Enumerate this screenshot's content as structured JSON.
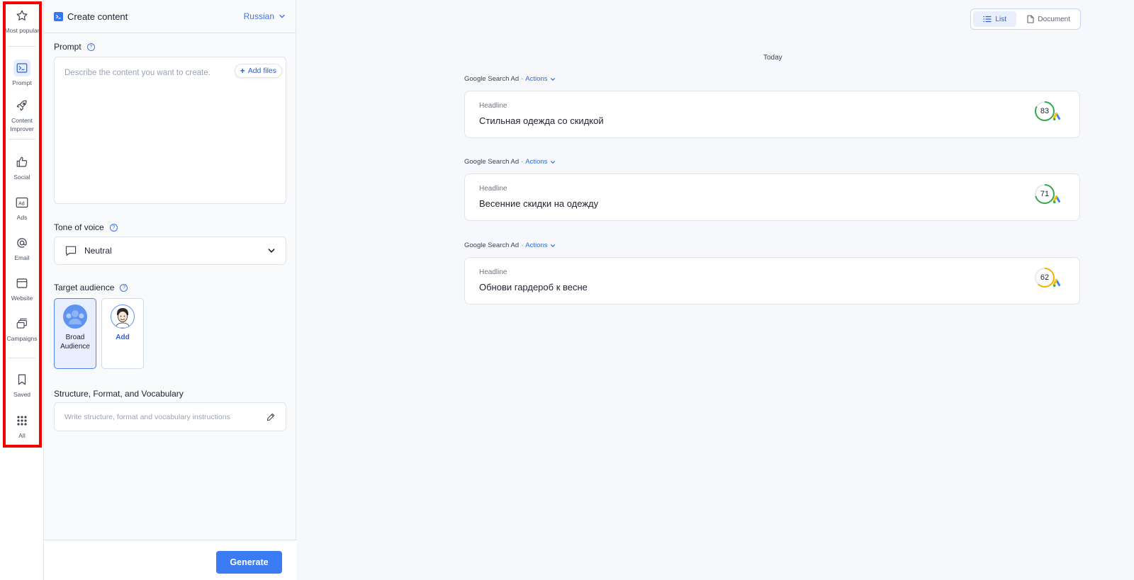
{
  "sidebar": {
    "items": [
      {
        "id": "most-popular",
        "label": "Most popular",
        "icon": "star-icon"
      },
      {
        "id": "prompt",
        "label": "Prompt",
        "icon": "terminal-icon",
        "active": true
      },
      {
        "id": "content-improver",
        "label": "Content Improver",
        "icon": "rocket-icon"
      },
      {
        "id": "social",
        "label": "Social",
        "icon": "thumbs-up-icon"
      },
      {
        "id": "ads",
        "label": "Ads",
        "icon": "ad-icon"
      },
      {
        "id": "email",
        "label": "Email",
        "icon": "at-icon"
      },
      {
        "id": "website",
        "label": "Website",
        "icon": "browser-window-icon"
      },
      {
        "id": "campaigns",
        "label": "Campaigns",
        "icon": "stacked-cards-icon"
      },
      {
        "id": "saved",
        "label": "Saved",
        "icon": "bookmark-icon"
      },
      {
        "id": "all",
        "label": "All",
        "icon": "grid-icon"
      }
    ],
    "highlight_color": "#f40000"
  },
  "panel": {
    "title": "Create content",
    "language": "Russian",
    "prompt": {
      "label": "Prompt",
      "placeholder": "Describe the content you want to create.",
      "add_files": "Add files"
    },
    "tone": {
      "label": "Tone of voice",
      "value": "Neutral"
    },
    "audience": {
      "label": "Target audience",
      "options": [
        {
          "name_line1": "Broad",
          "name_line2": "Audience",
          "selected": true
        },
        {
          "name_line1": "Add",
          "name_line2": "",
          "selected": false
        }
      ]
    },
    "structure": {
      "label": "Structure, Format, and Vocabulary",
      "placeholder": "Write structure, format and vocabulary instructions"
    },
    "generate": "Generate"
  },
  "results": {
    "view_toggle": {
      "list": "List",
      "document": "Document",
      "selected": "list"
    },
    "date_group": "Today",
    "cards": [
      {
        "type": "Google Search Ad",
        "actions": "Actions",
        "field": "Headline",
        "text": "Стильная одежда со скидкой",
        "score": 83,
        "score_color": "#34a853"
      },
      {
        "type": "Google Search Ad",
        "actions": "Actions",
        "field": "Headline",
        "text": "Весенние скидки на одежду",
        "score": 71,
        "score_color": "#34a853"
      },
      {
        "type": "Google Search Ad",
        "actions": "Actions",
        "field": "Headline",
        "text": "Обнови гардероб к весне",
        "score": 62,
        "score_color": "#f4b400"
      }
    ]
  },
  "colors": {
    "accent": "#3b74f0",
    "generate_button": "#3b7cf5"
  }
}
